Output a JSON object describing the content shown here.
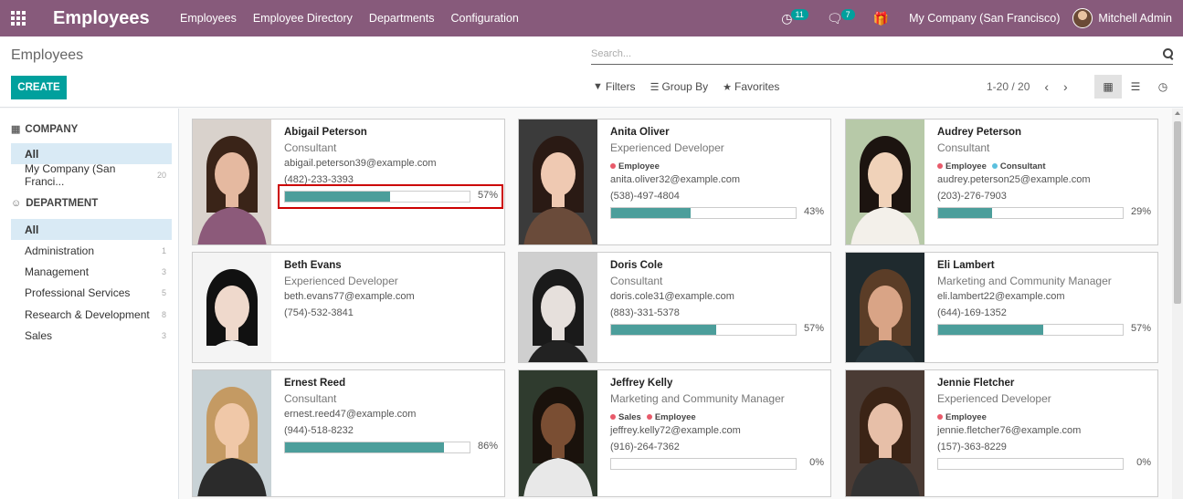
{
  "navbar": {
    "brand": "Employees",
    "menu": [
      "Employees",
      "Employee Directory",
      "Departments",
      "Configuration"
    ],
    "activity_count": "11",
    "messages_count": "7",
    "company": "My Company (San Francisco)",
    "user": "Mitchell Admin"
  },
  "control": {
    "breadcrumb": "Employees",
    "create_label": "CREATE",
    "search_placeholder": "Search...",
    "filters_label": "Filters",
    "groupby_label": "Group By",
    "favorites_label": "Favorites",
    "pager": "1-20 / 20"
  },
  "sidebar": {
    "company_header": "COMPANY",
    "company_items": [
      {
        "label": "All",
        "count": ""
      },
      {
        "label": "My Company (San Franci...",
        "count": "20"
      }
    ],
    "department_header": "DEPARTMENT",
    "department_items": [
      {
        "label": "All",
        "count": ""
      },
      {
        "label": "Administration",
        "count": "1"
      },
      {
        "label": "Management",
        "count": "3"
      },
      {
        "label": "Professional Services",
        "count": "5"
      },
      {
        "label": "Research & Development",
        "count": "8"
      },
      {
        "label": "Sales",
        "count": "3"
      }
    ]
  },
  "colors": {
    "brand": "#875a7b",
    "accent": "#00a09d",
    "progress": "#4c9e9b",
    "tag_employee": "#e85a6a",
    "tag_consultant": "#5bc0de",
    "tag_sales": "#e85a6a"
  },
  "employees": [
    {
      "name": "Abigail Peterson",
      "job": "Consultant",
      "tags": [],
      "email": "abigail.peterson39@example.com",
      "phone": "(482)-233-3393",
      "progress": 57,
      "pct": "57%"
    },
    {
      "name": "Anita Oliver",
      "job": "Experienced Developer",
      "tags": [
        "Employee"
      ],
      "email": "anita.oliver32@example.com",
      "phone": "(538)-497-4804",
      "progress": 43,
      "pct": "43%"
    },
    {
      "name": "Audrey Peterson",
      "job": "Consultant",
      "tags": [
        "Employee",
        "Consultant"
      ],
      "email": "audrey.peterson25@example.com",
      "phone": "(203)-276-7903",
      "progress": 29,
      "pct": "29%"
    },
    {
      "name": "Beth Evans",
      "job": "Experienced Developer",
      "tags": [],
      "email": "beth.evans77@example.com",
      "phone": "(754)-532-3841",
      "progress": null,
      "pct": ""
    },
    {
      "name": "Doris Cole",
      "job": "Consultant",
      "tags": [],
      "email": "doris.cole31@example.com",
      "phone": "(883)-331-5378",
      "progress": 57,
      "pct": "57%"
    },
    {
      "name": "Eli Lambert",
      "job": "Marketing and Community Manager",
      "tags": [],
      "email": "eli.lambert22@example.com",
      "phone": "(644)-169-1352",
      "progress": 57,
      "pct": "57%"
    },
    {
      "name": "Ernest Reed",
      "job": "Consultant",
      "tags": [],
      "email": "ernest.reed47@example.com",
      "phone": "(944)-518-8232",
      "progress": 86,
      "pct": "86%"
    },
    {
      "name": "Jeffrey Kelly",
      "job": "Marketing and Community Manager",
      "tags": [
        "Sales",
        "Employee"
      ],
      "email": "jeffrey.kelly72@example.com",
      "phone": "(916)-264-7362",
      "progress": 0,
      "pct": "0%"
    },
    {
      "name": "Jennie Fletcher",
      "job": "Experienced Developer",
      "tags": [
        "Employee"
      ],
      "email": "jennie.fletcher76@example.com",
      "phone": "(157)-363-8229",
      "progress": 0,
      "pct": "0%"
    }
  ]
}
